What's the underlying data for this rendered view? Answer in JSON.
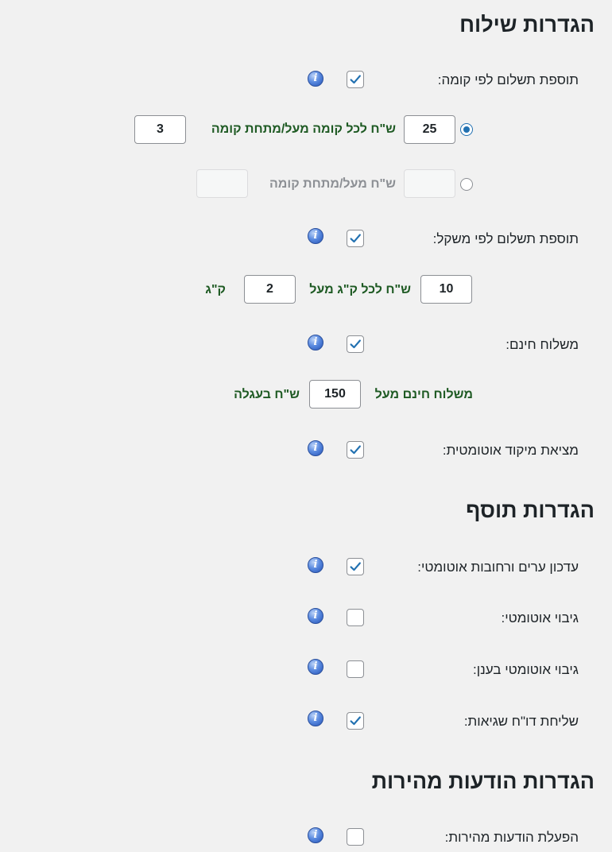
{
  "shipping": {
    "title": "הגדרות שילוח",
    "floor_fee_label": "תוספת תשלום לפי קומה:",
    "per_floor_value": "25",
    "per_floor_text": "ש\"ח לכל קומה מעל/מתחת קומה",
    "floor_threshold_value": "3",
    "flat_floor_value": "",
    "flat_floor_text": "ש\"ח מעל/מתחת קומה",
    "flat_floor_threshold_value": "",
    "weight_fee_label": "תוספת תשלום לפי משקל:",
    "per_kg_value": "10",
    "per_kg_text": "ש\"ח לכל ק\"ג מעל",
    "kg_threshold_value": "2",
    "kg_unit": "ק\"ג",
    "free_shipping_label": "משלוח חינם:",
    "free_over_text": "משלוח חינם מעל",
    "free_over_value": "150",
    "cart_text": "ש\"ח בעגלה",
    "auto_zip_label": "מציאת מיקוד אוטומטית:"
  },
  "plugin": {
    "title": "הגדרות תוסף",
    "auto_update_label": "עדכון ערים ורחובות אוטומטי:",
    "auto_backup_label": "גיבוי אוטומטי:",
    "cloud_backup_label": "גיבוי אוטומטי בענן:",
    "error_report_label": "שליחת דו\"ח שגיאות:"
  },
  "alerts": {
    "title": "הגדרות הודעות מהירות",
    "enable_label": "הפעלת הודעות מהירות:"
  },
  "info_icon_glyph": "i",
  "checkboxes": {
    "floor_fee": true,
    "weight_fee": true,
    "free_shipping": true,
    "auto_zip": true,
    "auto_update": true,
    "auto_backup": false,
    "cloud_backup": false,
    "error_report": true,
    "quick_alerts": false
  },
  "floor_mode_selected": "per_floor"
}
